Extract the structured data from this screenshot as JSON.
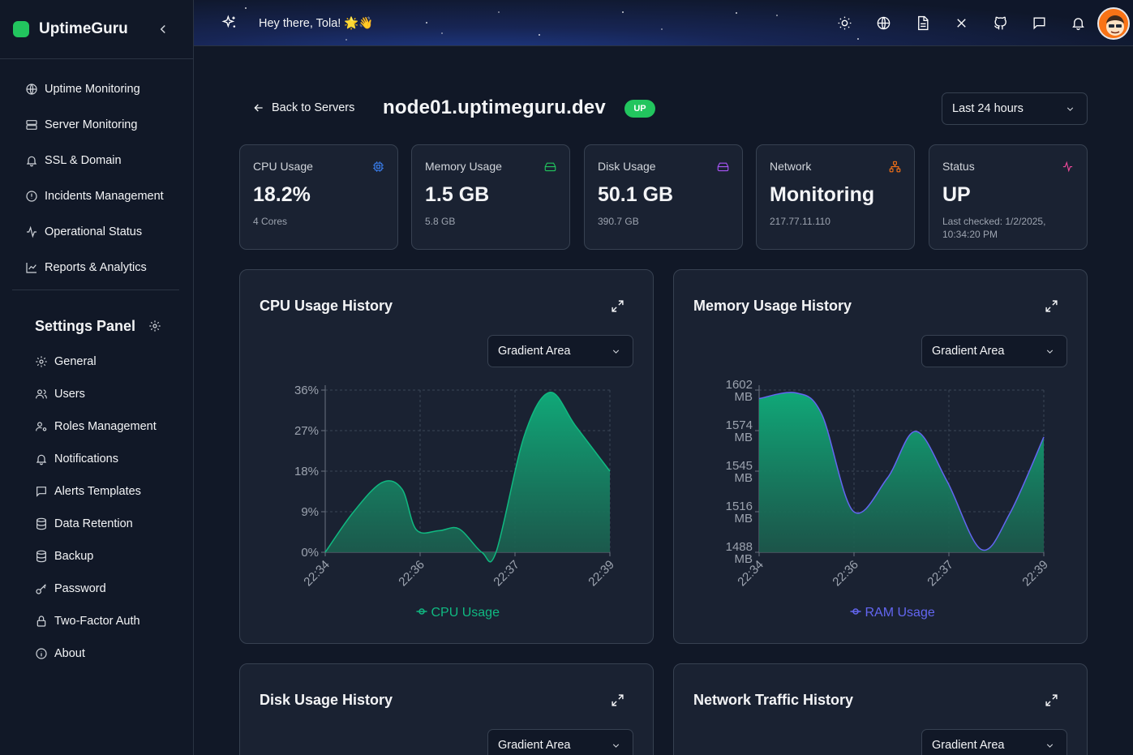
{
  "app": {
    "name": "UptimeGuru"
  },
  "topbar": {
    "greeting": "Hey there, Tola! 🌟👋"
  },
  "nav": {
    "items": [
      {
        "label": "Uptime Monitoring",
        "icon": "globe-icon"
      },
      {
        "label": "Server Monitoring",
        "icon": "server-icon"
      },
      {
        "label": "SSL & Domain",
        "icon": "bell-icon"
      },
      {
        "label": "Incidents Management",
        "icon": "alert-circle-icon"
      },
      {
        "label": "Operational Status",
        "icon": "activity-icon"
      },
      {
        "label": "Reports & Analytics",
        "icon": "line-chart-icon"
      }
    ]
  },
  "settings": {
    "title": "Settings Panel",
    "items": [
      {
        "label": "General",
        "icon": "gear-icon"
      },
      {
        "label": "Users",
        "icon": "users-icon"
      },
      {
        "label": "Roles Management",
        "icon": "user-cog-icon"
      },
      {
        "label": "Notifications",
        "icon": "bell-icon"
      },
      {
        "label": "Alerts Templates",
        "icon": "message-square-icon"
      },
      {
        "label": "Data Retention",
        "icon": "database-icon"
      },
      {
        "label": "Backup",
        "icon": "database-icon"
      },
      {
        "label": "Password",
        "icon": "key-icon"
      },
      {
        "label": "Two-Factor Auth",
        "icon": "lock-icon"
      },
      {
        "label": "About",
        "icon": "info-icon"
      }
    ]
  },
  "header": {
    "back_label": "Back to Servers",
    "hostname": "node01.uptimeguru.dev",
    "status_badge": "UP",
    "time_range": "Last 24 hours"
  },
  "stats": [
    {
      "label": "CPU Usage",
      "value": "18.2%",
      "sub": "4 Cores",
      "icon": "cpu-icon",
      "color": "#3b82f6"
    },
    {
      "label": "Memory Usage",
      "value": "1.5 GB",
      "sub": "5.8 GB",
      "icon": "hard-drive-icon",
      "color": "#22c55e"
    },
    {
      "label": "Disk Usage",
      "value": "50.1 GB",
      "sub": "390.7 GB",
      "icon": "hard-drive-icon",
      "color": "#a855f7"
    },
    {
      "label": "Network",
      "value": "Monitoring",
      "sub": "217.77.11.110",
      "icon": "network-icon",
      "color": "#f97316"
    },
    {
      "label": "Status",
      "value": "UP",
      "sub": "Last checked: 1/2/2025, 10:34:20 PM",
      "icon": "activity-icon",
      "color": "#ec4899"
    }
  ],
  "cards": {
    "cpu": {
      "title": "CPU Usage History",
      "mode": "Gradient Area"
    },
    "memory": {
      "title": "Memory Usage History",
      "mode": "Gradient Area"
    },
    "disk": {
      "title": "Disk Usage History",
      "mode": "Gradient Area"
    },
    "network": {
      "title": "Network Traffic History",
      "mode": "Gradient Area"
    }
  },
  "chart_data": [
    {
      "type": "area",
      "title": "CPU Usage History",
      "x_ticks": [
        "22:34",
        "22:36",
        "22:37",
        "22:39"
      ],
      "y_ticks": [
        "0%",
        "9%",
        "18%",
        "27%",
        "36%"
      ],
      "ylim": [
        0,
        36
      ],
      "series": [
        {
          "name": "CPU Usage",
          "color": "#10b981",
          "x": [
            0,
            0.1,
            0.2,
            0.27,
            0.32,
            0.4,
            0.47,
            0.55,
            0.6,
            0.7,
            0.79,
            0.88,
            1.0
          ],
          "values": [
            0,
            9,
            15.5,
            14,
            5,
            4.8,
            5.2,
            0,
            0,
            26,
            35.5,
            28,
            18
          ]
        }
      ],
      "grid": true,
      "legend": "bottom"
    },
    {
      "type": "area",
      "title": "Memory Usage History",
      "x_ticks": [
        "22:34",
        "22:36",
        "22:37",
        "22:39"
      ],
      "y_ticks": [
        "1488 MB",
        "1516 MB",
        "1545 MB",
        "1574 MB",
        "1602 MB"
      ],
      "ylim": [
        1488,
        1602
      ],
      "series": [
        {
          "name": "RAM Usage",
          "color": "#6366f1",
          "x": [
            0,
            0.13,
            0.22,
            0.33,
            0.45,
            0.55,
            0.66,
            0.78,
            0.88,
            1.0
          ],
          "values": [
            1596,
            1600,
            1585,
            1517,
            1540,
            1573,
            1538,
            1490,
            1515,
            1569
          ]
        }
      ],
      "grid": true,
      "legend": "bottom"
    }
  ]
}
